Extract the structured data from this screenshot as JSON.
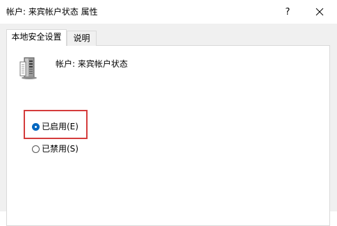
{
  "window": {
    "title": "帐户: 来宾帐户状态 属性",
    "help_glyph": "?",
    "close_icon": "close-icon"
  },
  "tabs": [
    {
      "label": "本地安全设置",
      "active": true
    },
    {
      "label": "说明",
      "active": false
    }
  ],
  "policy": {
    "icon": "server-icon",
    "name": "帐户: 来宾帐户状态"
  },
  "options": {
    "enabled": {
      "label": "已启用(E)",
      "selected": true
    },
    "disabled": {
      "label": "已禁用(S)",
      "selected": false
    }
  },
  "colors": {
    "accent": "#0067c0",
    "highlight_border": "#d43b3b",
    "window_bg": "#f0f0f0",
    "panel_bg": "#ffffff"
  }
}
